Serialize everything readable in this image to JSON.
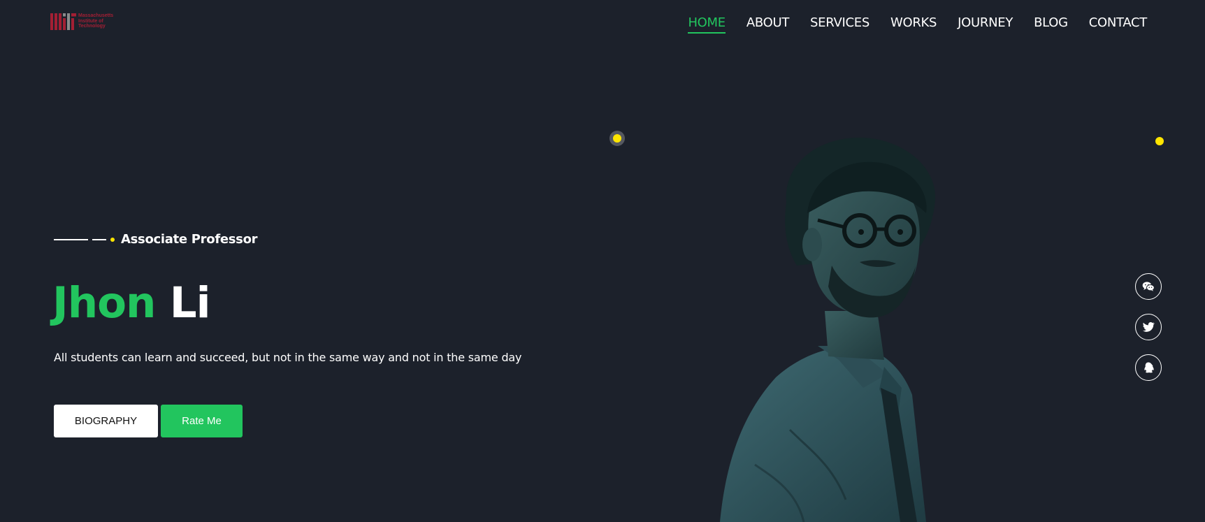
{
  "header": {
    "logo": {
      "line1": "Massachusetts",
      "line2": "Institute of",
      "line3": "Technology",
      "color": "#a31f34"
    },
    "nav": [
      {
        "label": "HOME",
        "active": true
      },
      {
        "label": "ABOUT",
        "active": false
      },
      {
        "label": "SERVICES",
        "active": false
      },
      {
        "label": "WORKS",
        "active": false
      },
      {
        "label": "JOURNEY",
        "active": false
      },
      {
        "label": "BLOG",
        "active": false
      },
      {
        "label": "CONTACT",
        "active": false
      }
    ]
  },
  "hero": {
    "subtitle": "Associate Professor",
    "name_first": "Jhon",
    "name_last": "Li",
    "tagline": "All students can learn and succeed, but not in the same way and not in the same day",
    "buttons": {
      "biography": "BIOGRAPHY",
      "rate": "Rate Me"
    }
  },
  "social": [
    {
      "icon": "wechat-icon"
    },
    {
      "icon": "twitter-icon"
    },
    {
      "icon": "qq-icon"
    }
  ],
  "colors": {
    "background": "#1c212b",
    "accent": "#22c55e",
    "highlight": "#ffe500",
    "text": "#ffffff"
  }
}
